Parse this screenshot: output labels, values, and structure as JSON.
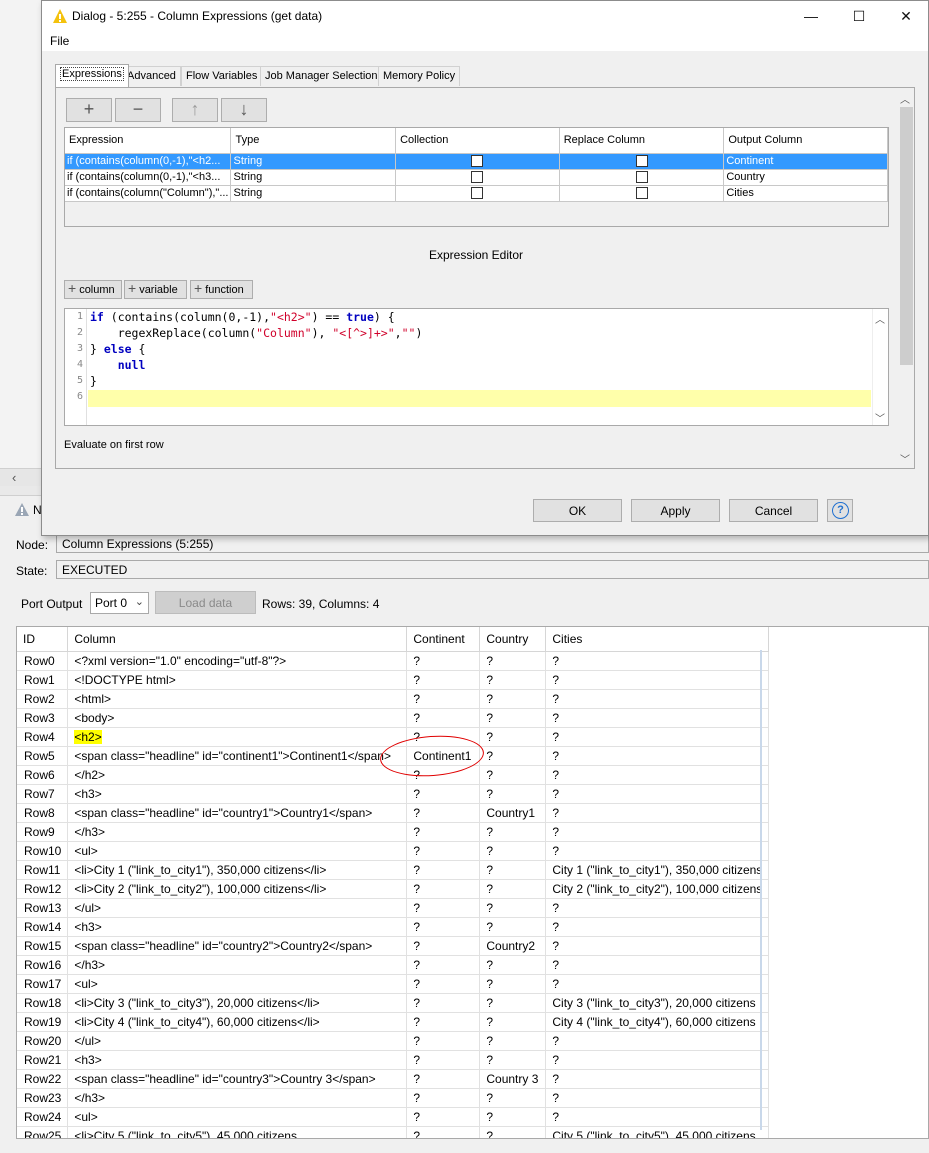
{
  "dialog": {
    "title": "Dialog - 5:255 - Column Expressions (get data)",
    "menu_file": "File",
    "window_buttons": {
      "minimize": "—",
      "maximize": "☐",
      "close": "✕"
    },
    "tabs": [
      "Expressions",
      "Advanced",
      "Flow Variables",
      "Job Manager Selection",
      "Memory Policy"
    ],
    "toolbar_icons": [
      "plus-icon",
      "minus-icon",
      "arrow-up-icon",
      "arrow-down-icon"
    ],
    "expr_table": {
      "headers": [
        "Expression",
        "Type",
        "Collection",
        "Replace Column",
        "Output Column"
      ],
      "rows": [
        {
          "expression": "if (contains(column(0,-1),\"<h2...",
          "type": "String",
          "output": "Continent",
          "selected": true
        },
        {
          "expression": "if (contains(column(0,-1),\"<h3...",
          "type": "String",
          "output": "Country",
          "selected": false
        },
        {
          "expression": "if (contains(column(\"Column\"),\"...",
          "type": "String",
          "output": "Cities",
          "selected": false
        }
      ]
    },
    "editor_title": "Expression Editor",
    "insert_buttons": [
      "column",
      "variable",
      "function"
    ],
    "code_line_numbers": [
      "1",
      "2",
      "3",
      "4",
      "5",
      "6"
    ],
    "evaluate_label": "Evaluate on first row",
    "buttons": {
      "ok": "OK",
      "apply": "Apply",
      "cancel": "Cancel",
      "help": "?"
    }
  },
  "node_view": {
    "tab_label": "N",
    "node_label": "Node:",
    "node_value": "Column Expressions  (5:255)",
    "state_label": "State:",
    "state_value": "EXECUTED",
    "port_output_label": "Port Output",
    "port_selected": "Port 0",
    "load_data_label": "Load data",
    "rows_info": "Rows: 39, Columns: 4"
  },
  "data_table": {
    "headers": [
      "ID",
      "Column",
      "Continent",
      "Country",
      "Cities"
    ],
    "rows": [
      [
        "Row0",
        "<?xml version=\"1.0\" encoding=\"utf-8\"?>",
        "?",
        "?",
        "?"
      ],
      [
        "Row1",
        "<!DOCTYPE html>",
        "?",
        "?",
        "?"
      ],
      [
        "Row2",
        "<html>",
        "?",
        "?",
        "?"
      ],
      [
        "Row3",
        "<body>",
        "?",
        "?",
        "?"
      ],
      [
        "Row4",
        "<h2>",
        "?",
        "?",
        "?"
      ],
      [
        "Row5",
        "<span class=\"headline\" id=\"continent1\">Continent1</span>",
        "Continent1",
        "?",
        "?"
      ],
      [
        "Row6",
        "</h2>",
        "?",
        "?",
        "?"
      ],
      [
        "Row7",
        "<h3>",
        "?",
        "?",
        "?"
      ],
      [
        "Row8",
        "<span class=\"headline\" id=\"country1\">Country1</span>",
        "?",
        "Country1",
        "?"
      ],
      [
        "Row9",
        "</h3>",
        "?",
        "?",
        "?"
      ],
      [
        "Row10",
        "<ul>",
        "?",
        "?",
        "?"
      ],
      [
        "Row11",
        "<li>City 1 (\"link_to_city1\"), 350,000 citizens</li>",
        "?",
        "?",
        "City 1 (\"link_to_city1\"), 350,000 citizens"
      ],
      [
        "Row12",
        "<li>City 2 (\"link_to_city2\"), 100,000 citizens</li>",
        "?",
        "?",
        "City 2 (\"link_to_city2\"), 100,000 citizens"
      ],
      [
        "Row13",
        "</ul>",
        "?",
        "?",
        "?"
      ],
      [
        "Row14",
        "<h3>",
        "?",
        "?",
        "?"
      ],
      [
        "Row15",
        "<span class=\"headline\" id=\"country2\">Country2</span>",
        "?",
        "Country2",
        "?"
      ],
      [
        "Row16",
        "</h3>",
        "?",
        "?",
        "?"
      ],
      [
        "Row17",
        "<ul>",
        "?",
        "?",
        "?"
      ],
      [
        "Row18",
        "<li>City 3 (\"link_to_city3\"), 20,000 citizens</li>",
        "?",
        "?",
        "City 3 (\"link_to_city3\"), 20,000 citizens"
      ],
      [
        "Row19",
        "<li>City 4 (\"link_to_city4\"), 60,000 citizens</li>",
        "?",
        "?",
        "City 4 (\"link_to_city4\"), 60,000 citizens"
      ],
      [
        "Row20",
        "</ul>",
        "?",
        "?",
        "?"
      ],
      [
        "Row21",
        "<h3>",
        "?",
        "?",
        "?"
      ],
      [
        "Row22",
        "<span class=\"headline\" id=\"country3\">Country 3</span>",
        "?",
        "Country 3",
        "?"
      ],
      [
        "Row23",
        "</h3>",
        "?",
        "?",
        "?"
      ],
      [
        "Row24",
        "<ul>",
        "?",
        "?",
        "?"
      ],
      [
        "Row25",
        "<li>City 5 (\"link_to_city5\"), 45,000 citizens",
        "?",
        "?",
        "City 5 (\"link_to_city5\"), 45,000 citizens"
      ]
    ],
    "highlighted_row": "Row4",
    "circled_value": "Continent1"
  },
  "colors": {
    "selection": "#3399ff",
    "highlight": "#ffff00",
    "annotation": "#e00000",
    "keyword": "#0000c0",
    "string": "#d0002a"
  }
}
